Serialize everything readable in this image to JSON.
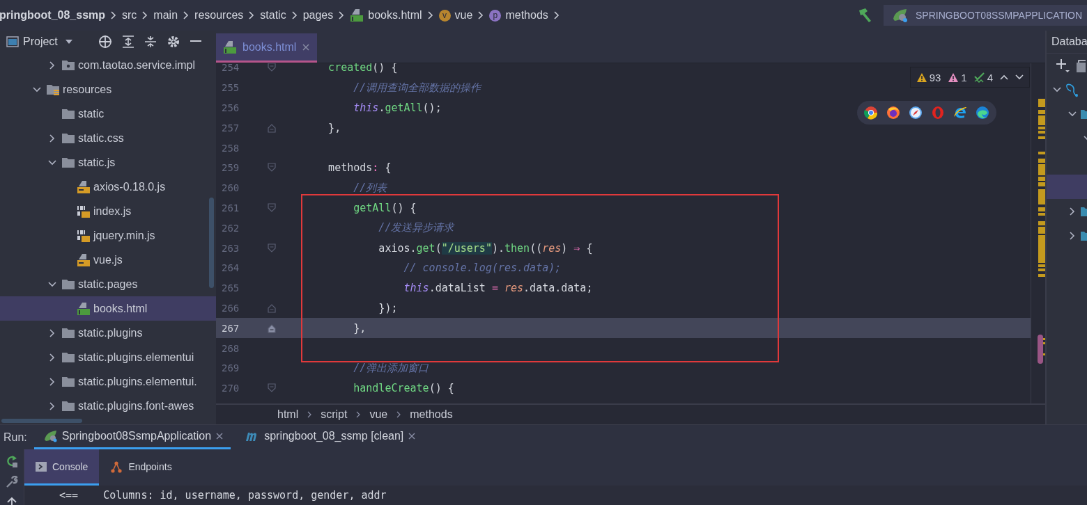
{
  "navigation_bar": {
    "breadcrumbs": [
      {
        "label": "pringboot_08_ssmp",
        "kind": "project"
      },
      {
        "label": "src",
        "kind": "plain"
      },
      {
        "label": "main",
        "kind": "plain"
      },
      {
        "label": "resources",
        "kind": "plain"
      },
      {
        "label": "static",
        "kind": "plain"
      },
      {
        "label": "pages",
        "kind": "plain"
      },
      {
        "label": "books.html",
        "kind": "html"
      },
      {
        "label": "vue",
        "kind": "vue",
        "badge": "v"
      },
      {
        "label": "methods",
        "kind": "property",
        "badge": "p"
      }
    ],
    "run_configuration": "SPRINGBOOT08SSMPAPPLICATION"
  },
  "project_panel": {
    "title": "Project",
    "tree": [
      {
        "children": [
          {
            "label": "com.taotao.service.impl",
            "kind": "package",
            "expanded": false,
            "selected": false
          }
        ]
      },
      {
        "label": "resources",
        "kind": "resources",
        "expanded": true,
        "selected": false,
        "children": [
          {
            "label": "static",
            "kind": "folder",
            "selected": false
          },
          {
            "label": "static.css",
            "kind": "folder",
            "expanded": false,
            "selected": false
          },
          {
            "label": "static.js",
            "kind": "folder",
            "expanded": true,
            "selected": false,
            "children": [
              {
                "label": "axios-0.18.0.js",
                "kind": "js",
                "selected": false
              },
              {
                "label": "index.js",
                "kind": "minjs",
                "selected": false
              },
              {
                "label": "jquery.min.js",
                "kind": "minjs",
                "selected": false
              },
              {
                "label": "vue.js",
                "kind": "js",
                "selected": false
              }
            ]
          },
          {
            "label": "static.pages",
            "kind": "folder",
            "expanded": true,
            "selected": false,
            "children": [
              {
                "label": "books.html",
                "kind": "html",
                "selected": true
              }
            ]
          },
          {
            "label": "static.plugins",
            "kind": "folder",
            "expanded": false,
            "selected": false
          },
          {
            "label": "static.plugins.elementui",
            "kind": "folder",
            "expanded": false,
            "selected": false
          },
          {
            "label": "static.plugins.elementui.",
            "kind": "folder",
            "expanded": false,
            "selected": false
          },
          {
            "label": "static.plugins.font-awes",
            "kind": "folder",
            "expanded": false,
            "selected": false
          }
        ]
      }
    ]
  },
  "editor": {
    "tabs": [
      {
        "label": "books.html",
        "kind": "html",
        "selected": true
      }
    ],
    "inspections": {
      "warnings": "93",
      "weak_warnings": "1",
      "typos": "4"
    },
    "lines": [
      {
        "kind": "line",
        "number": "254",
        "fold_marker": {
          "kind": "start"
        },
        "current": false,
        "tokens": [
          {
            "kind": "fn",
            "text": "    created"
          },
          {
            "kind": "plain",
            "text": "() {"
          }
        ]
      },
      {
        "kind": "line",
        "number": "255",
        "current": false,
        "tokens": [
          {
            "kind": "comment",
            "text": "        //调用查询全部数据的操作"
          }
        ]
      },
      {
        "kind": "line",
        "number": "256",
        "current": false,
        "tokens": [
          {
            "kind": "keyword",
            "text": "        this"
          },
          {
            "kind": "plain",
            "text": "."
          },
          {
            "kind": "fn",
            "text": "getAll"
          },
          {
            "kind": "plain",
            "text": "();"
          }
        ]
      },
      {
        "kind": "line",
        "number": "257",
        "fold_marker": {
          "kind": "end"
        },
        "current": false,
        "tokens": [
          {
            "kind": "plain",
            "text": "    },"
          }
        ]
      },
      {
        "kind": "line",
        "number": "258",
        "current": false
      },
      {
        "kind": "line",
        "number": "259",
        "fold_marker": {
          "kind": "start"
        },
        "current": false,
        "tokens": [
          {
            "kind": "plain",
            "text": "    methods"
          },
          {
            "kind": "op",
            "text": ":"
          },
          {
            "kind": "plain",
            "text": " {"
          }
        ]
      },
      {
        "kind": "line",
        "number": "260",
        "current": false,
        "tokens": [
          {
            "kind": "comment",
            "text": "        //列表"
          }
        ]
      },
      {
        "kind": "highlight_box",
        "lines": [
          {
            "number": "261",
            "fold_marker": {
              "kind": "start"
            },
            "current": false,
            "tokens": [
              {
                "kind": "fn",
                "text": "        getAll"
              },
              {
                "kind": "plain",
                "text": "() {"
              }
            ]
          },
          {
            "number": "262",
            "current": false,
            "tokens": [
              {
                "kind": "comment",
                "text": "            //发送异步请求"
              }
            ]
          },
          {
            "number": "263",
            "fold_marker": {
              "kind": "start"
            },
            "current": false,
            "tokens": [
              {
                "kind": "plain",
                "text": "            axios."
              },
              {
                "kind": "fn",
                "text": "get"
              },
              {
                "kind": "plain",
                "text": "("
              },
              {
                "kind": "string",
                "text": "\"/users\""
              },
              {
                "kind": "plain",
                "text": ")."
              },
              {
                "kind": "fn",
                "text": "then"
              },
              {
                "kind": "plain",
                "text": "(("
              },
              {
                "kind": "param",
                "text": "res"
              },
              {
                "kind": "plain",
                "text": ") "
              },
              {
                "kind": "op",
                "text": "⇒"
              },
              {
                "kind": "plain",
                "text": " {"
              }
            ]
          },
          {
            "number": "264",
            "current": false,
            "tokens": [
              {
                "kind": "comment",
                "text": "                // console.log(res.data);"
              }
            ]
          },
          {
            "number": "265",
            "current": false,
            "tokens": [
              {
                "kind": "keyword",
                "text": "                this"
              },
              {
                "kind": "plain",
                "text": ".dataList "
              },
              {
                "kind": "op",
                "text": "="
              },
              {
                "kind": "param",
                "text": " res"
              },
              {
                "kind": "plain",
                "text": ".data.data;"
              }
            ]
          },
          {
            "number": "266",
            "fold_marker": {
              "kind": "end"
            },
            "current": false,
            "tokens": [
              {
                "kind": "plain",
                "text": "            });"
              }
            ]
          },
          {
            "number": "267",
            "fold_marker": {
              "kind": "end"
            },
            "current": true,
            "tokens": [
              {
                "kind": "plain",
                "text": "        },"
              }
            ]
          },
          {
            "number": "268",
            "current": false
          }
        ]
      },
      {
        "kind": "line",
        "number": "269",
        "current": false,
        "tokens": [
          {
            "kind": "comment",
            "text": "        //弹出添加窗口"
          }
        ]
      },
      {
        "kind": "line",
        "number": "270",
        "fold_marker": {
          "kind": "start"
        },
        "current": false,
        "tokens": [
          {
            "kind": "fn",
            "text": "        handleCreate"
          },
          {
            "kind": "plain",
            "text": "() {"
          }
        ]
      }
    ],
    "breadcrumbs": [
      "html",
      "script",
      "vue",
      "methods"
    ]
  },
  "database_panel": {
    "title": "Databa",
    "tree": [
      {
        "kind": "database",
        "expanded": true,
        "selected": false,
        "children": [
          {
            "kind": "folder",
            "expanded": true,
            "selected": false,
            "children": [
              {
                "expanded": true,
                "selected": false,
                "children": [
                  {
                    "selected": false
                  },
                  {
                    "selected": true
                  }
                ]
              }
            ]
          },
          {
            "kind": "folder",
            "expanded": false,
            "selected": false
          },
          {
            "kind": "folder",
            "expanded": false,
            "selected": false
          }
        ]
      }
    ]
  },
  "run_panel": {
    "label": "Run:",
    "tabs": [
      {
        "label": "Springboot08SsmpApplication",
        "kind": "spring",
        "selected": true
      },
      {
        "label": "springboot_08_ssmp [clean]",
        "kind": "maven",
        "selected": false
      }
    ],
    "subtabs": [
      {
        "label": "Console",
        "kind": "console",
        "selected": true
      },
      {
        "label": "Endpoints",
        "kind": "endpoints",
        "selected": false
      }
    ],
    "output": [
      "<==    Columns: id, username, password, gender, addr"
    ]
  }
}
